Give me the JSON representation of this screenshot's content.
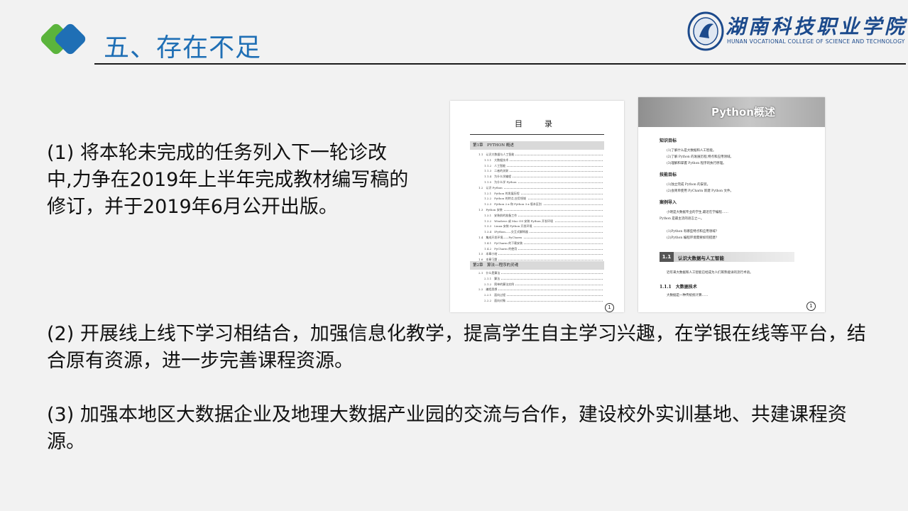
{
  "header": {
    "title": "五、存在不足",
    "accent_blue": "#1f6fb5",
    "accent_green": "#5bb43c"
  },
  "school": {
    "name_cn": "湖南科技职业学院",
    "name_en": "HUNAN VOCATIONAL COLLEGE OF SCIENCE AND TECHNOLOGY"
  },
  "points": [
    "(1) 将本轮未完成的任务列入下一轮诊改中,力争在2019年上半年完成教材编写稿的修订，并于2019年6月公开出版。",
    "(2) 开展线上线下学习相结合，加强信息化教学，提高学生自主学习兴趣，在学银在线等平台，结合原有资源，进一步完善课程资源。",
    "(3) 加强本地区大数据企业及地理大数据产业园的交流与合作，建设校外实训基地、共建课程资源。"
  ],
  "book_toc": {
    "heading": "目　录",
    "chapter1": "第1章　PYTHON 概述",
    "rows": [
      "1.1　认识大数据与人工智能",
      "1.1.1　大数据技术",
      "1.1.2　人工智能",
      "1.1.3　二者的关联",
      "1.1.4　为什么学编程",
      "1.1.5　为什么学 Python",
      "1.2　认识 Python",
      "1.2.1　Python 的发展历程",
      "1.2.2　Python 的特点,应用领域",
      "1.2.3　Python 2.x 和 Python 3.x 版本区别",
      "1.3　Python 安装",
      "1.3.1　安装前的准备工作",
      "1.3.2　Windows 或 Mac OS 安装 Python 开发环境",
      "1.3.3　Linux 安装 Python 开发环境",
      "1.3.4　IPython——交互式解释器",
      "1.4　集成开发环境——PyCharm",
      "1.4.1　PyCharm 的下载安装",
      "1.4.2　PyCharm 的使用",
      "1.5　本章小结",
      "1.6　本章习题"
    ],
    "chapter2": "第2章　算法—程序的灵魂",
    "rows2": [
      "2.1　什么是算法",
      "2.1.1　算法",
      "2.1.2　简单的算法实例",
      "2.2　编程思想",
      "2.2.1　面向过程",
      "2.2.2　面向对象"
    ],
    "page": "1"
  },
  "book_intro": {
    "title": "Python概述",
    "h1": "知识目标",
    "t1": [
      "(1)了解什么是大数据和人工智能。",
      "(2)了解 Python 的发展历程,特点和应用领域。",
      "(3)理解和掌握 Python 程序的执行原理。"
    ],
    "h2": "技能目标",
    "t2": [
      "(1)独立完成 Python 的安装。",
      "(2)会简单使用 PyCharm 新建 Python 文件。"
    ],
    "h3": "案例导入",
    "t3": [
      "小明是大数据专业的学生,最近在学编程……",
      "Python 是最主流的语言之一。",
      "(1)Python 有哪些特点和应用领域?",
      "(2)Python 编程环境需要如何搭建?"
    ],
    "section_badge": "1.1",
    "section_title": "认识大数据与人工智能",
    "t4": [
      "近年来大数据和人工智能已经成为人们耳熟能详的流行术语。",
      "1.1.1　大数据技术",
      "大数据是一种传统统计算……"
    ],
    "page": "1"
  }
}
